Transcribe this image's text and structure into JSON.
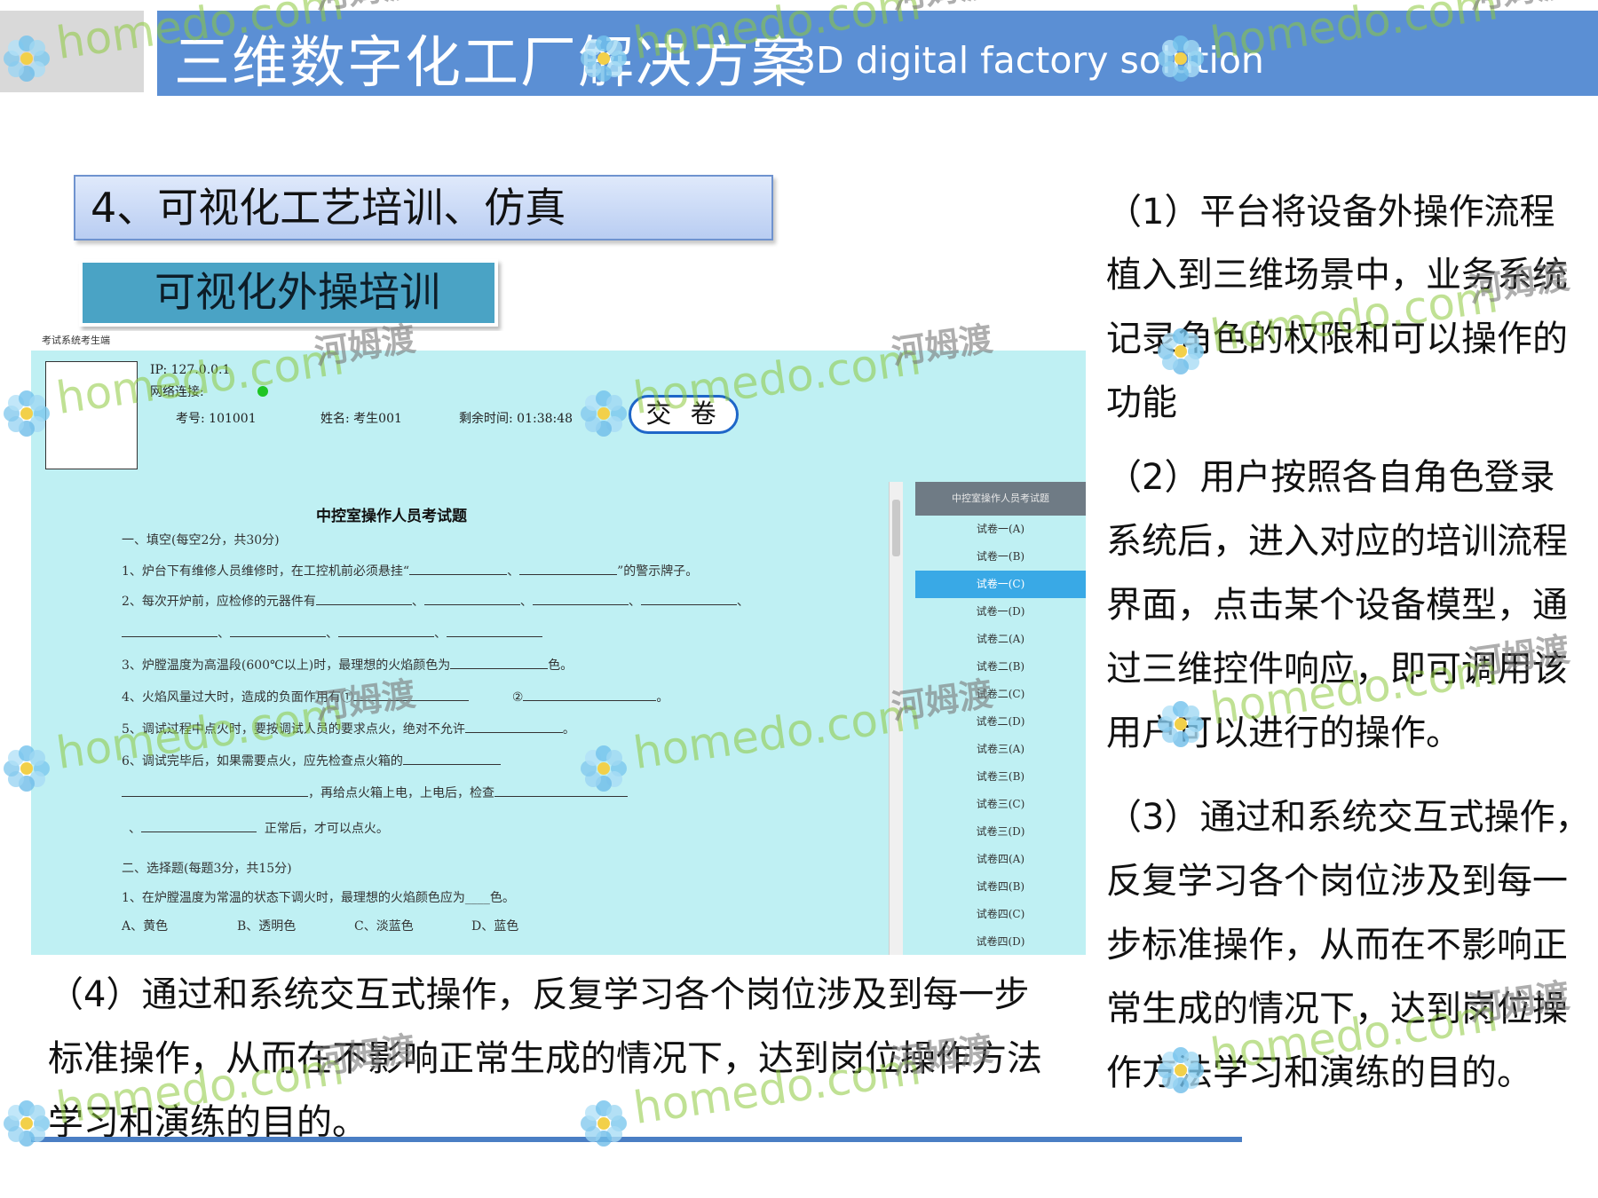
{
  "header": {
    "title": "三维数字化工厂解决方案",
    "subtitle": "3D digital factory solution"
  },
  "section": {
    "title": "4、可视化工艺培训、仿真",
    "subtitle": "可视化外操培训"
  },
  "screenshot": {
    "window_title": "考试系统考生端",
    "ip": "IP: 127.0.0.1",
    "network": "网络连接:",
    "exam_no": "考号: 101001",
    "name": "姓名: 考生001",
    "remaining": "剩余时间: 01:38:48",
    "submit": "交 卷",
    "paper_title": "中控室操作人员考试题",
    "questions": {
      "sec1": "一、填空(每空2分，共30分)",
      "q1a": "1、炉台下有维修人员维修时，在工控机前必须悬挂“",
      "q1b": "”的警示牌子。",
      "q2": "2、每次开炉前，应检修的元器件有",
      "q3a": "3、炉膛温度为高温段(600℃以上)时，最理想的火焰颜色为",
      "q3b": "色。",
      "q4a": "4、火焰风量过大时，造成的负面作用有①",
      "q4b": "②",
      "q5": "5、调试过程中点火时，要按调试人员的要求点火，绝对不允许",
      "q6a": "6、调试完毕后，如果需要点火，应先检查点火箱的",
      "q6b": "，再给点火箱上电，上电后，检查",
      "q6c": "正常后，才可以点火。",
      "sec2": "二、选择题(每题3分，共15分)",
      "c1": "1、在炉膛温度为常温的状态下调火时，最理想的火焰颜色应为____色。",
      "c1_options": [
        "A、黄色",
        "B、透明色",
        "C、淡蓝色",
        "D、蓝色"
      ]
    },
    "side_header": "中控室操作人员考试题",
    "side_items": [
      "试卷一(A)",
      "试卷一(B)",
      "试卷一(C)",
      "试卷一(D)",
      "试卷二(A)",
      "试卷二(B)",
      "试卷二(C)",
      "试卷二(D)",
      "试卷三(A)",
      "试卷三(B)",
      "试卷三(C)",
      "试卷三(D)",
      "试卷四(A)",
      "试卷四(B)",
      "试卷四(C)",
      "试卷四(D)"
    ],
    "selected_index": 2
  },
  "right_text": {
    "lines": [
      "（1）平台将设备外操作流程",
      "植入到三维场景中，业务系统",
      "记录角色的权限和可以操作的",
      "功能",
      "（2）用户按照各自角色登录",
      "系统后，进入对应的培训流程",
      "界面，点击某个设备模型，通",
      "过三维控件响应，即可调用该",
      "用户可以进行的操作。",
      "（3）通过和系统交互式操作，",
      "反复学习各个岗位涉及到每一",
      "步标准操作，从而在不影响正",
      "常生成的情况下，达到岗位操",
      "作方法学习和演练的目的。"
    ]
  },
  "bottom_text": {
    "lines": [
      "（4）通过和系统交互式操作，反复学习各个岗位涉及到每一步",
      "标准操作，从而在不影响正常生成的情况下，达到岗位操作方法",
      "学习和演练的目的。"
    ]
  },
  "watermark": {
    "brand": "homedo.com",
    "cn": "河姆渡"
  },
  "colors": {
    "header_bar": "#5b8fd4",
    "section_box": "#b9cdf2",
    "sub_box": "#4aa3c5",
    "screenshot_bg": "#bff0f3",
    "submit_border": "#1e66c8",
    "side_selected": "#39a9e6",
    "bottom_rule": "#4a7ec4"
  }
}
